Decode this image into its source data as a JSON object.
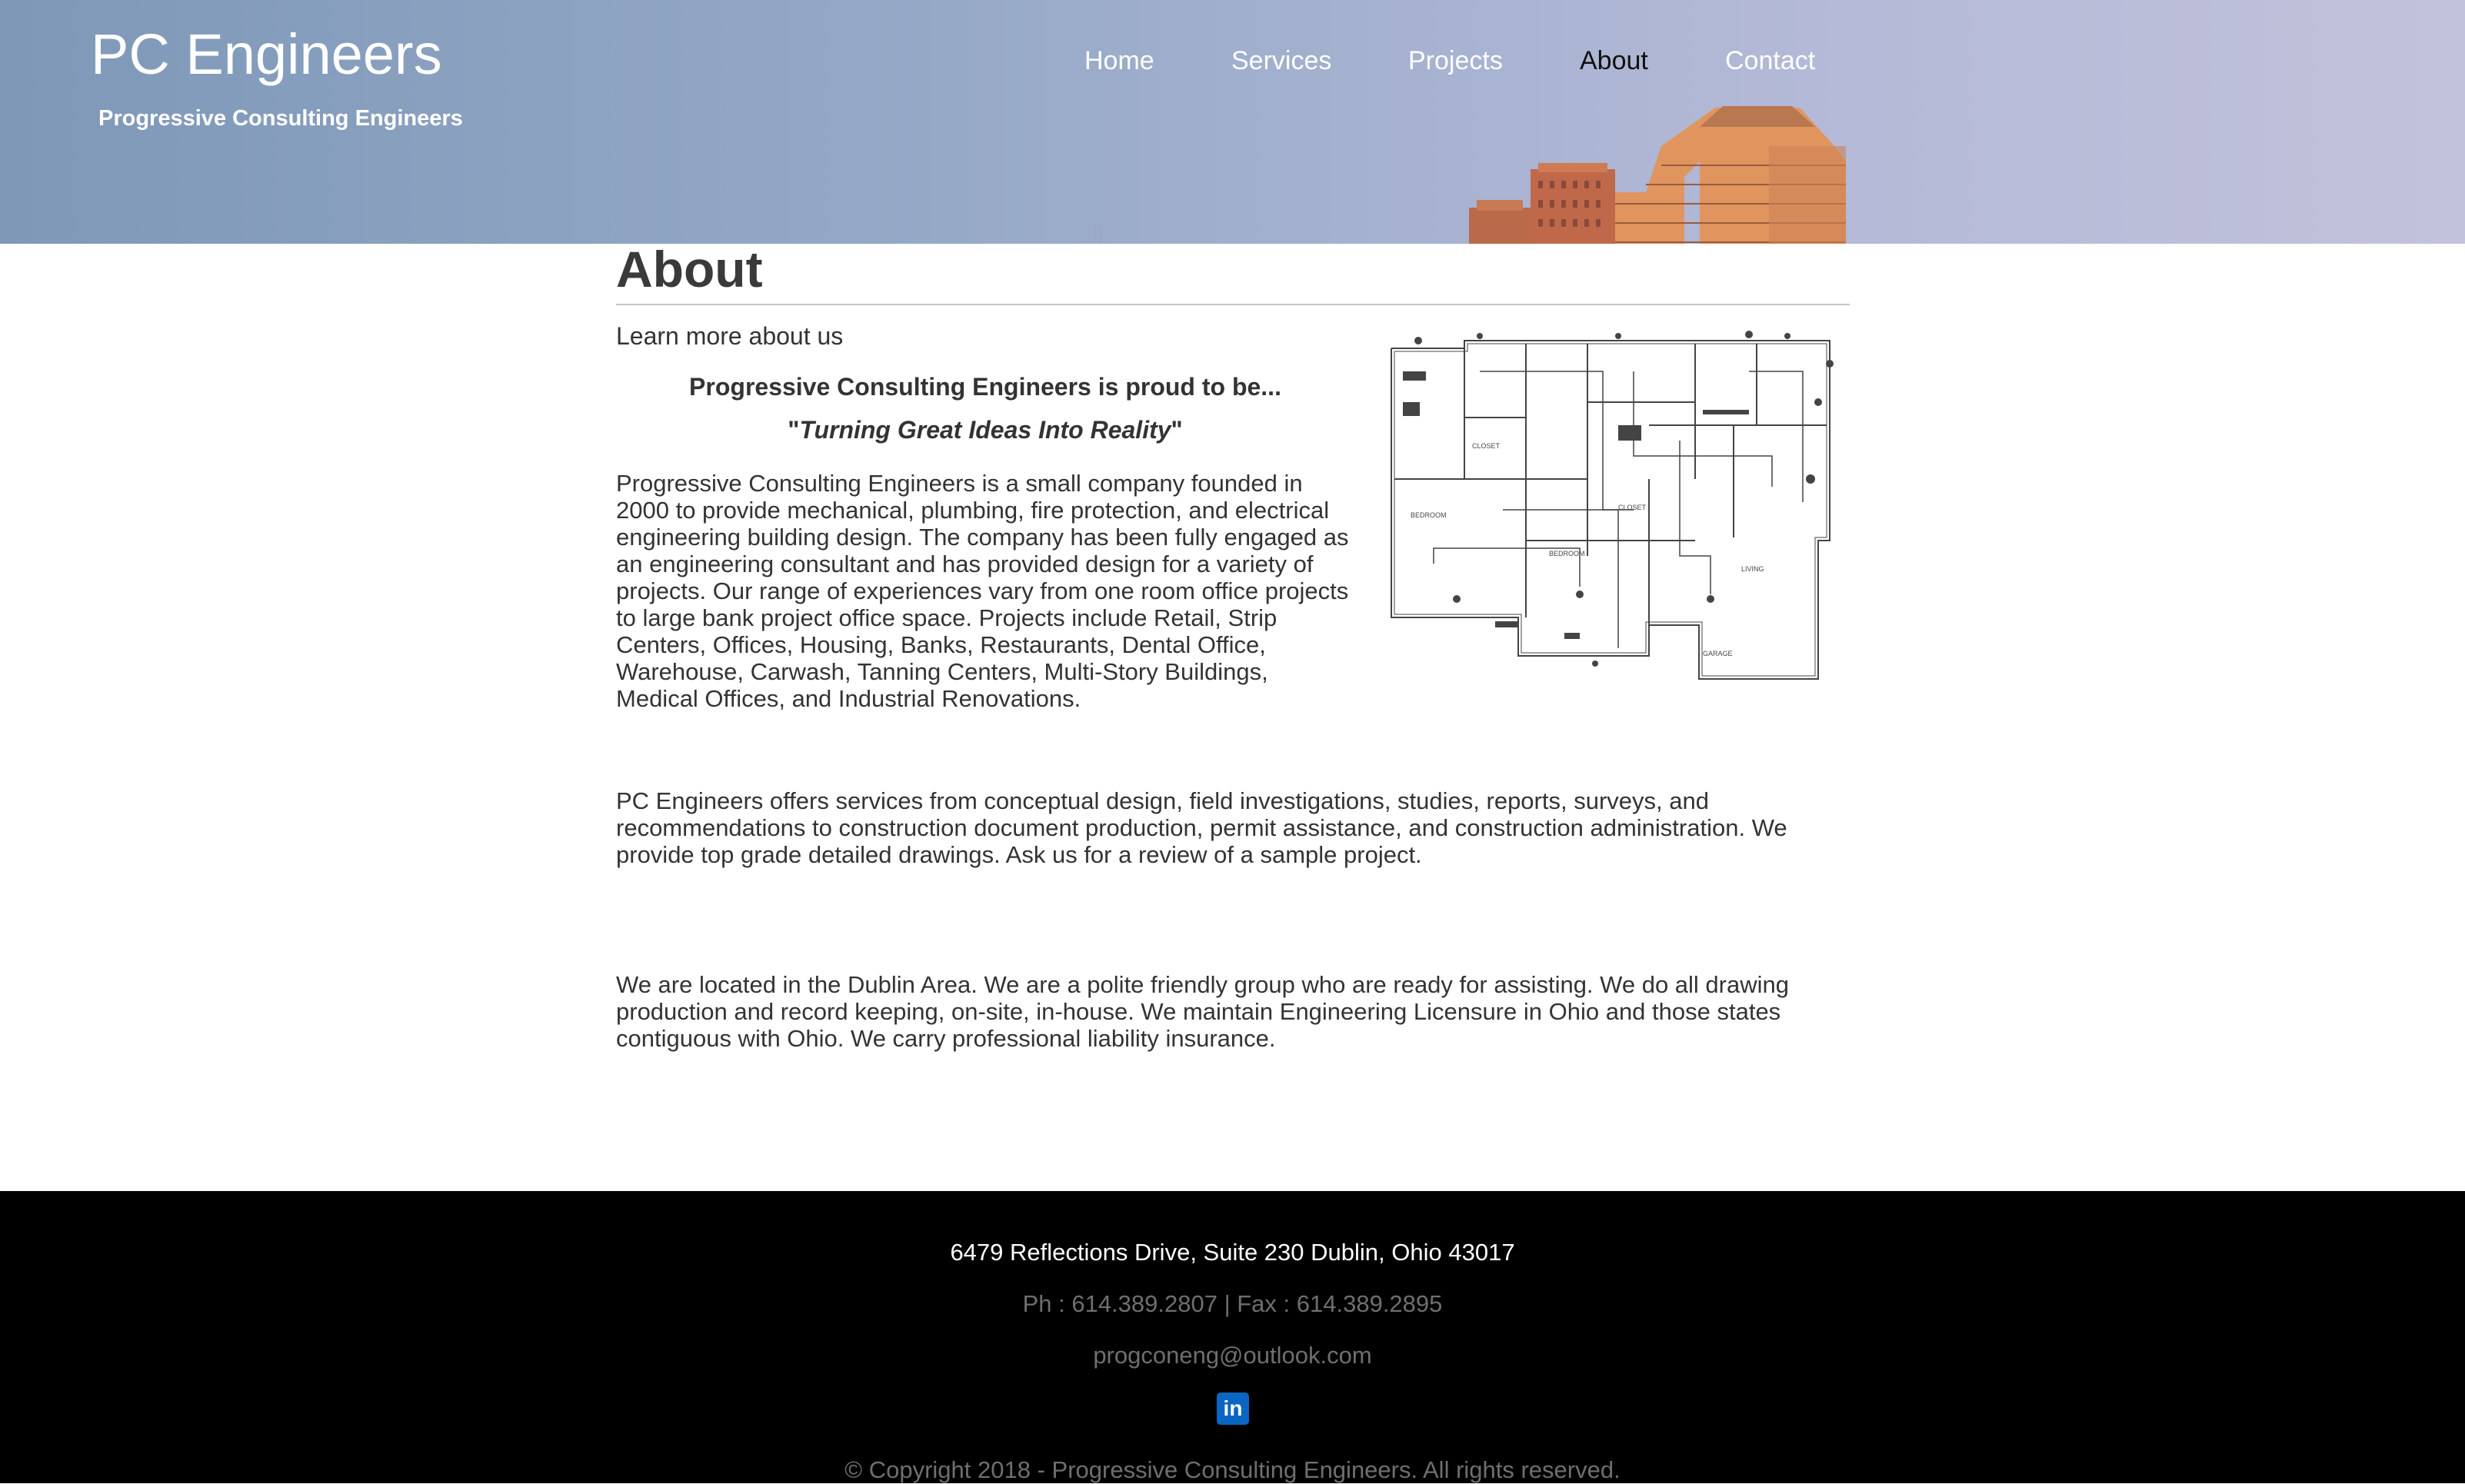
{
  "header": {
    "title": "PC Engineers",
    "tagline": "Progressive Consulting Engineers",
    "nav": [
      {
        "label": "Home",
        "active": false
      },
      {
        "label": "Services",
        "active": false
      },
      {
        "label": "Projects",
        "active": false
      },
      {
        "label": "About",
        "active": true
      },
      {
        "label": "Contact",
        "active": false
      }
    ]
  },
  "main": {
    "title": "About",
    "intro": "Learn more about us",
    "proud": "Progressive Consulting Engineers is proud to be...",
    "slogan_quote": "\"",
    "slogan": "Turning Great Ideas Into Reality",
    "paragraphs": [
      "Progressive Consulting Engineers is a small company founded in 2000 to provide mechanical, plumbing, fire protection, and electrical engineering building design. The company has been fully engaged as an engineering consultant and has provided design for a variety of projects. Our range of experiences vary from one room office projects to large bank project office space. Projects include Retail, Strip Centers, Offices, Housing, Banks, Restaurants, Dental Office, Warehouse, Carwash, Tanning Centers, Multi-Story Buildings, Medical Offices, and Industrial Renovations.",
      "PC Engineers offers services from conceptual design, field investigations, studies, reports, surveys, and recommendations to construction document production, permit assistance, and construction administration. We provide top grade detailed drawings. Ask us for a review of a sample project.",
      "We are located in the Dublin Area. We are a polite friendly group who are ready for assisting. We do all drawing production and record keeping, on-site, in-house. We maintain Engineering Licensure in Ohio and those states contiguous with Ohio. We carry professional liability insurance."
    ]
  },
  "footer": {
    "address": "6479 Reflections Drive, Suite 230 Dublin, Ohio 43017",
    "phone": "Ph : 614.389.2807 | Fax : 614.389.2895",
    "email": "progconeng@outlook.com",
    "linkedin_icon": "linkedin-icon",
    "linkedin_label": "in",
    "copyright": "© Copyright 2018 - Progressive Consulting Engineers. All rights reserved."
  },
  "colors": {
    "header_start": "#7f98b8",
    "header_end": "#c2c2db",
    "footer_bg": "#000000",
    "linkedin": "#0a66c2",
    "text": "#333333"
  }
}
